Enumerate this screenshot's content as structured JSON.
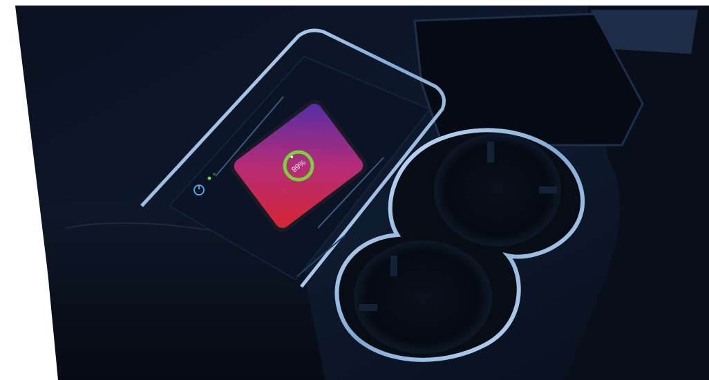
{
  "photo": {
    "subject": "car-center-console-wireless-charger",
    "background_color": "#ffffff",
    "console_color": "#0b1322",
    "trim_color": "#9fc2e6",
    "phone_gradient": [
      "#e0303a",
      "#b42a7c",
      "#5a2fae"
    ],
    "indicator_color": "#6fd14f",
    "power_icon_color": "#5aa8ff"
  },
  "phone_screen": {
    "battery_text": "99%",
    "battery_level": 0.99,
    "ring_color": "#7bd13a"
  }
}
